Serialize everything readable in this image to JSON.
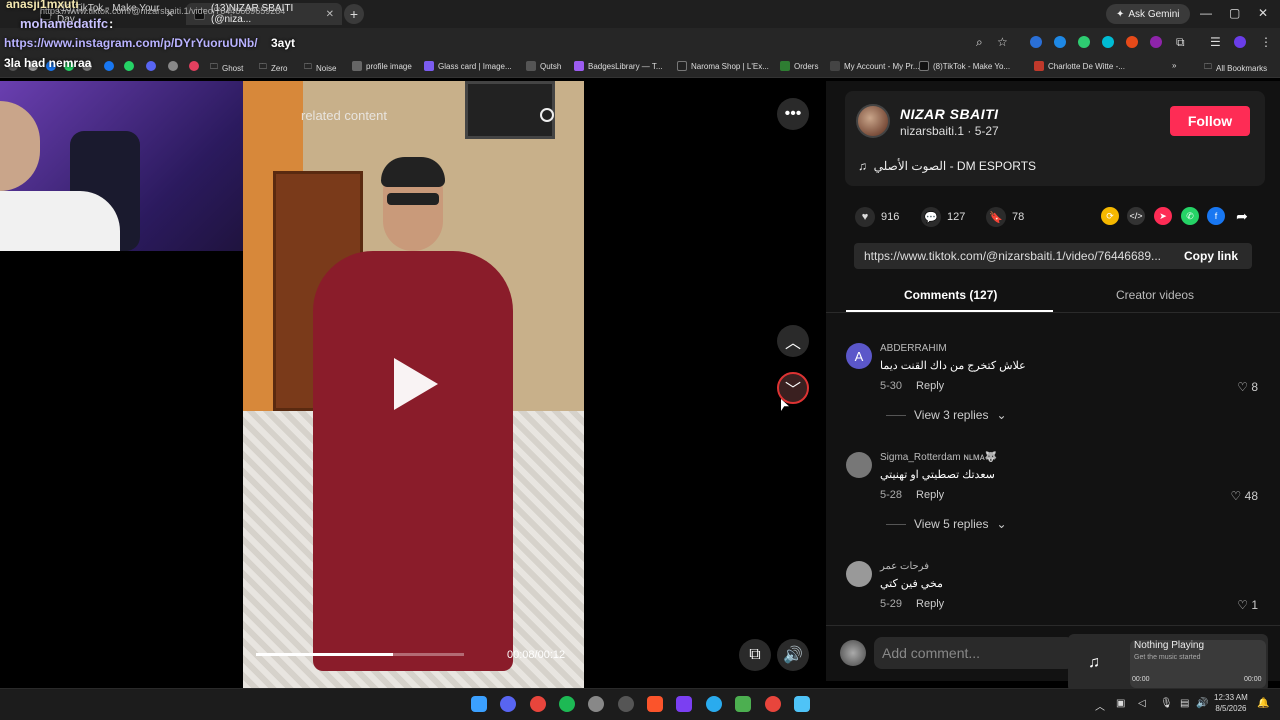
{
  "browser": {
    "tabs": [
      {
        "label": "(13)TikTok - Make Your Day"
      },
      {
        "label": "(13)NIZAR SBAITI (@niza..."
      }
    ],
    "new_tab": "+",
    "ask_gemini": "Ask Gemini",
    "url": "https://www.tiktok.com/@nizarsbaiti.1/video/76446689659284",
    "bookmarks": [
      {
        "label": "Ghost",
        "icon": "folder-icon"
      },
      {
        "label": "Zero",
        "icon": "folder-icon"
      },
      {
        "label": "Noise",
        "icon": "folder-icon"
      },
      {
        "label": "profile image",
        "icon": "bookmark-icon"
      },
      {
        "label": "Glass card | Image...",
        "icon": "bookmark-icon"
      },
      {
        "label": "Qutsh",
        "icon": "bookmark-icon"
      },
      {
        "label": "BadgesLibrary — T...",
        "icon": "bookmark-icon"
      },
      {
        "label": "Naroma Shop | L'Ex...",
        "icon": "bookmark-icon"
      },
      {
        "label": "Orders",
        "icon": "bookmark-icon"
      },
      {
        "label": "My Account - My Pr...",
        "icon": "bookmark-icon"
      },
      {
        "label": "(8)TikTok - Make Yo...",
        "icon": "bookmark-icon"
      },
      {
        "label": "Charlotte De Witte -...",
        "icon": "bookmark-icon"
      }
    ],
    "all_bookmarks": "All Bookmarks"
  },
  "stream_overlay": {
    "name1": "anasji1mxuti",
    "name2": "mohamedatifc",
    "name2_colon": ":",
    "chat_link": "https://www.instagram.com/p/DYrYuoruUNb/",
    "chat_word": "3ayt",
    "name3": "3la had nemraa"
  },
  "video": {
    "related_label": "related content",
    "time": "00:08/00:12",
    "progress": 0.66
  },
  "author": {
    "name": "NIZAR SBAITI",
    "handle": "nizarsbaiti.1 · 5-27",
    "follow": "Follow",
    "music_icon": "♫",
    "music": "الصوت الأصلي - DM ESPORTS"
  },
  "stats": {
    "likes": "916",
    "comments": "127",
    "saves": "78"
  },
  "link": {
    "url": "https://www.tiktok.com/@nizarsbaiti.1/video/76446689...",
    "copy": "Copy link"
  },
  "tabs": {
    "comments": "Comments (127)",
    "creator": "Creator videos"
  },
  "comments": [
    {
      "initial": "A",
      "user": "ABDERRAHIM",
      "text": "علاش كتخرج من داك القنت ديما",
      "date": "5-30",
      "reply": "Reply",
      "likes": "8",
      "view_replies": "View 3 replies",
      "avatar_color": "#5b57c9"
    },
    {
      "initial": "",
      "user": "Sigma_Rotterdam ɴʟᴍᴀ🐺",
      "text": "سعدتك تصطيتي او تهنيتي",
      "date": "5-28",
      "reply": "Reply",
      "likes": "48",
      "view_replies": "View 5 replies",
      "avatar_color": "#777777"
    },
    {
      "initial": "",
      "user": "فرحات عمر",
      "text": "مخي فين كتي",
      "date": "5-29",
      "reply": "Reply",
      "likes": "1",
      "view_replies": "",
      "avatar_color": "#999999"
    }
  ],
  "add_comment": "Add comment...",
  "media": {
    "title": "Nothing Playing",
    "subtitle": "Get the music started",
    "t_start": "00:00",
    "t_end": "00:00"
  },
  "clock": {
    "time": "12:33 AM",
    "date": "8/5/2026"
  },
  "colors": {
    "follow": "#fe2c55",
    "accent_outline": "#dd3333"
  }
}
